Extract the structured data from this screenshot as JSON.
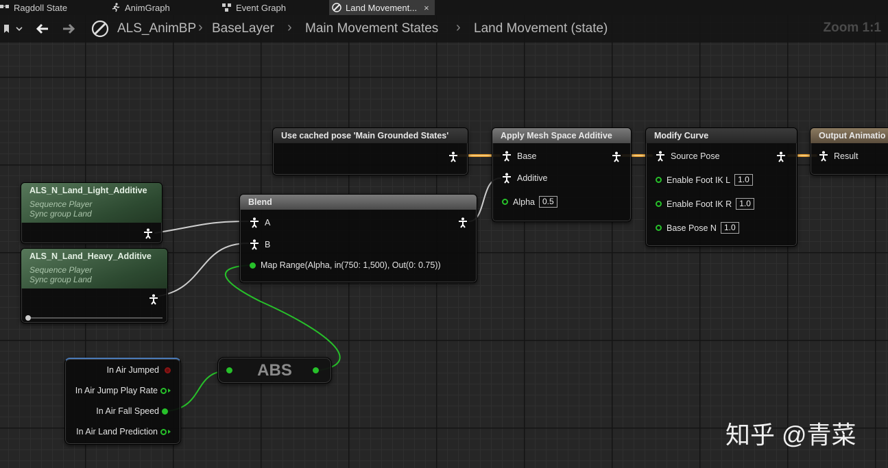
{
  "tabs": [
    {
      "label": "Ragdoll State",
      "icon": "state-machine-icon"
    },
    {
      "label": "AnimGraph",
      "icon": "running-man-icon"
    },
    {
      "label": "Event Graph",
      "icon": "event-graph-icon"
    },
    {
      "label": "Land Movement...",
      "icon": "anim-blueprint-icon",
      "active": true,
      "close": "×"
    }
  ],
  "breadcrumb": {
    "items": [
      "ALS_AnimBP",
      "BaseLayer",
      "Main Movement States",
      "Land Movement (state)"
    ],
    "zoom": "Zoom 1:1"
  },
  "nodes": {
    "cached_pose": {
      "title": "Use cached pose 'Main Grounded States'"
    },
    "apply_additive": {
      "title": "Apply Mesh Space Additive",
      "base": "Base",
      "additive": "Additive",
      "alpha": "Alpha",
      "alpha_value": "0.5"
    },
    "modify_curve": {
      "title": "Modify Curve",
      "source_pose": "Source Pose",
      "pins": [
        {
          "label": "Enable Foot IK L",
          "value": "1.0"
        },
        {
          "label": "Enable Foot IK R",
          "value": "1.0"
        },
        {
          "label": "Base Pose N",
          "value": "1.0"
        }
      ]
    },
    "output": {
      "title": "Output Animatio",
      "result": "Result"
    },
    "seq_light": {
      "title": "ALS_N_Land_Light_Additive",
      "sub1": "Sequence Player",
      "sub2": "Sync group Land"
    },
    "seq_heavy": {
      "title": "ALS_N_Land_Heavy_Additive",
      "sub1": "Sequence Player",
      "sub2": "Sync group Land"
    },
    "blend": {
      "title": "Blend",
      "a": "A",
      "b": "B",
      "alpha_expr": "Map Range(Alpha, in(750: 1,500), Out(0: 0.75))"
    },
    "abs": {
      "title": "ABS"
    },
    "vars": {
      "items": [
        "In Air Jumped",
        "In Air Jump Play Rate",
        "In Air Fall Speed",
        "In Air Land Prediction"
      ]
    }
  },
  "watermark": "知乎 @青菜",
  "colors": {
    "float_pin": "#27c02a",
    "exec_wire": "#e89b2a",
    "pose_wire": "#dcdcdc"
  }
}
